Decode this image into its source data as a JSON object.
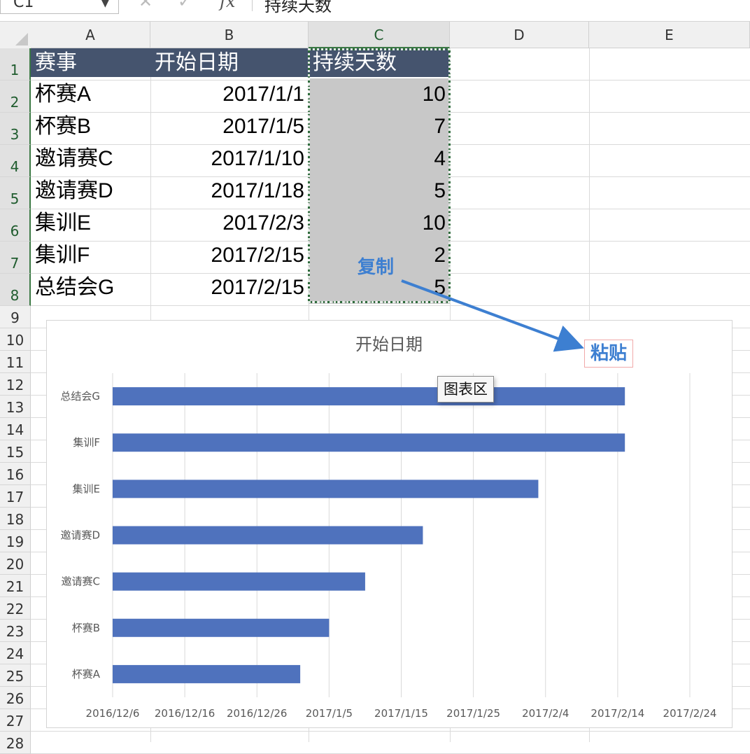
{
  "formula_bar": {
    "name_box": "C1",
    "cancel_icon": "✕",
    "enter_icon": "✓",
    "fx_label": "fx",
    "formula": "持续天数"
  },
  "columns": [
    "A",
    "B",
    "C",
    "D",
    "E"
  ],
  "rows": [
    "1",
    "2",
    "3",
    "4",
    "5",
    "6",
    "7",
    "8",
    "9",
    "10",
    "11",
    "12",
    "13",
    "14",
    "15",
    "16",
    "17",
    "18",
    "19",
    "20",
    "21",
    "22",
    "23",
    "24",
    "25",
    "26",
    "27",
    "28"
  ],
  "table": {
    "headers": [
      "赛事",
      "开始日期",
      "持续天数"
    ],
    "rows": [
      [
        "杯赛A",
        "2017/1/1",
        "10"
      ],
      [
        "杯赛B",
        "2017/1/5",
        "7"
      ],
      [
        "邀请赛C",
        "2017/1/10",
        "4"
      ],
      [
        "邀请赛D",
        "2017/1/18",
        "5"
      ],
      [
        "集训E",
        "2017/2/3",
        "10"
      ],
      [
        "集训F",
        "2017/2/15",
        "2"
      ],
      [
        "总结会G",
        "2017/2/15",
        "5"
      ]
    ]
  },
  "annotations": {
    "copy": "复制",
    "paste": "粘贴",
    "tooltip": "图表区"
  },
  "colors": {
    "bar": "#4f72bd",
    "header_fill": "#45546e",
    "selection": "#2f6b3c",
    "annotation": "#3d7fd1"
  },
  "chart_data": {
    "type": "bar",
    "orientation": "horizontal",
    "title": "开始日期",
    "categories": [
      "总结会G",
      "集训F",
      "集训E",
      "邀请赛D",
      "邀请赛C",
      "杯赛B",
      "杯赛A"
    ],
    "series": [
      {
        "values": [
          "2017/2/15",
          "2017/2/15",
          "2017/2/3",
          "2017/1/18",
          "2017/1/10",
          "2017/1/5",
          "2017/1/1"
        ]
      }
    ],
    "x_tick_labels": [
      "2016/12/6",
      "2016/12/16",
      "2016/12/26",
      "2017/1/5",
      "2017/1/15",
      "2017/1/25",
      "2017/2/4",
      "2017/2/14",
      "2017/2/24"
    ],
    "xlim": [
      "2016/12/6",
      "2017/2/24"
    ],
    "grid": true,
    "legend": "none"
  }
}
